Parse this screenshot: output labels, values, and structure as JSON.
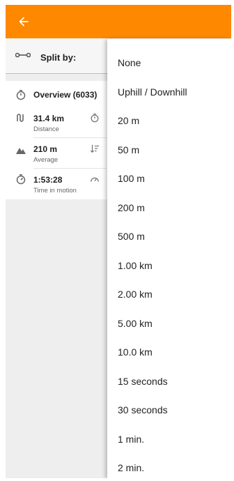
{
  "toolbar": {
    "back_icon": "arrow-back-icon",
    "color": "#fe8800"
  },
  "split": {
    "label": "Split by:",
    "icon": "route-split-icon"
  },
  "stats": {
    "overview": "Overview (6033)",
    "distance": {
      "value": "31.4 km",
      "label": "Distance"
    },
    "elevation": {
      "value": "210 m",
      "label": "Average"
    },
    "time": {
      "value": "1:53:28",
      "label": "Time in motion"
    }
  },
  "menu": {
    "items": [
      "None",
      "Uphill / Downhill",
      "20 m",
      "50 m",
      "100 m",
      "200 m",
      "500 m",
      "1.00 km",
      "2.00 km",
      "5.00 km",
      "10.0 km",
      "15 seconds",
      "30 seconds",
      "1 min.",
      "2 min."
    ]
  }
}
